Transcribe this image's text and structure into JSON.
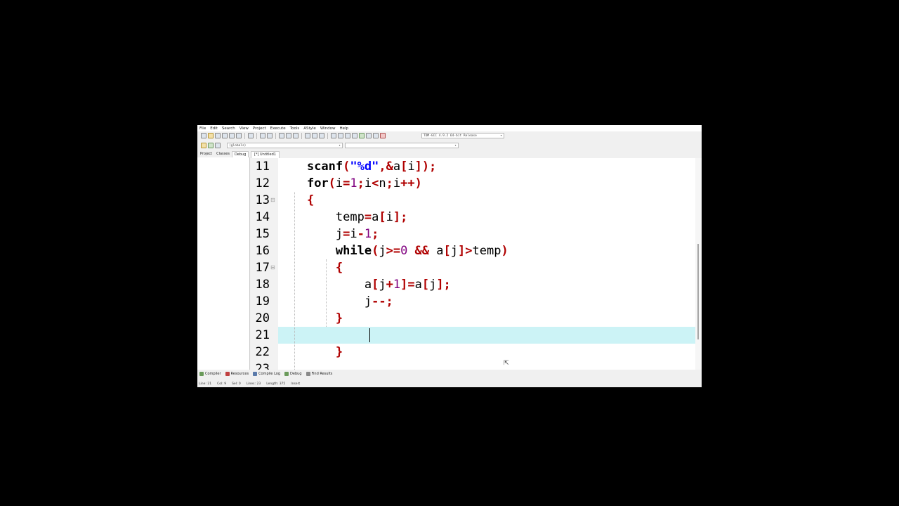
{
  "menu": [
    "File",
    "Edit",
    "Search",
    "View",
    "Project",
    "Execute",
    "Tools",
    "AStyle",
    "Window",
    "Help"
  ],
  "compiler_select": "TDM-GCC 4.9.2 64-bit Release",
  "globals_select": "(globals)",
  "left_tabs": [
    "Project",
    "Classes",
    "Debug"
  ],
  "document_tab": "[*] Untitled1",
  "editor": {
    "lines": [
      {
        "n": "11",
        "code": [
          [
            "",
            "    "
          ],
          [
            "k",
            "scanf"
          ],
          [
            "p",
            "("
          ],
          [
            "s",
            "\"%d\""
          ],
          [
            "p",
            ",&"
          ],
          [
            "",
            "a"
          ],
          [
            "p",
            "["
          ],
          [
            "",
            "i"
          ],
          [
            "p",
            "]);"
          ]
        ]
      },
      {
        "n": "12",
        "code": [
          [
            "",
            "    "
          ],
          [
            "k",
            "for"
          ],
          [
            "p",
            "("
          ],
          [
            "",
            "i"
          ],
          [
            "p",
            "="
          ],
          [
            "n",
            "1"
          ],
          [
            "p",
            ";"
          ],
          [
            "",
            "i"
          ],
          [
            "p",
            "<"
          ],
          [
            "",
            "n"
          ],
          [
            "p",
            ";"
          ],
          [
            "",
            "i"
          ],
          [
            "p",
            "++)"
          ]
        ]
      },
      {
        "n": "13",
        "code": [
          [
            "",
            "    "
          ],
          [
            "p",
            "{"
          ]
        ]
      },
      {
        "n": "14",
        "code": [
          [
            "",
            "        "
          ],
          [
            "",
            "temp"
          ],
          [
            "p",
            "="
          ],
          [
            "",
            "a"
          ],
          [
            "p",
            "["
          ],
          [
            "",
            "i"
          ],
          [
            "p",
            "];"
          ]
        ]
      },
      {
        "n": "15",
        "code": [
          [
            "",
            "        "
          ],
          [
            "",
            "j"
          ],
          [
            "p",
            "="
          ],
          [
            "",
            "i"
          ],
          [
            "p",
            "-"
          ],
          [
            "n",
            "1"
          ],
          [
            "p",
            ";"
          ]
        ]
      },
      {
        "n": "16",
        "code": [
          [
            "",
            "        "
          ],
          [
            "k",
            "while"
          ],
          [
            "p",
            "("
          ],
          [
            "",
            "j"
          ],
          [
            "p",
            ">="
          ],
          [
            "n",
            "0"
          ],
          [
            "",
            ""
          ],
          [
            "p",
            " && "
          ],
          [
            "",
            "a"
          ],
          [
            "p",
            "["
          ],
          [
            "",
            "j"
          ],
          [
            "p",
            "]>"
          ],
          [
            "",
            "temp"
          ],
          [
            "p",
            ")"
          ]
        ]
      },
      {
        "n": "17",
        "code": [
          [
            "",
            "        "
          ],
          [
            "p",
            "{"
          ]
        ]
      },
      {
        "n": "18",
        "code": [
          [
            "",
            "            "
          ],
          [
            "",
            "a"
          ],
          [
            "p",
            "["
          ],
          [
            "",
            "j"
          ],
          [
            "p",
            "+"
          ],
          [
            "n",
            "1"
          ],
          [
            "p",
            "]="
          ],
          [
            "",
            "a"
          ],
          [
            "p",
            "["
          ],
          [
            "",
            "j"
          ],
          [
            "p",
            "];"
          ]
        ]
      },
      {
        "n": "19",
        "code": [
          [
            "",
            "            "
          ],
          [
            "",
            "j"
          ],
          [
            "p",
            "--;"
          ]
        ]
      },
      {
        "n": "20",
        "code": [
          [
            "",
            "        "
          ],
          [
            "p",
            "}"
          ]
        ]
      },
      {
        "n": "21",
        "code": [
          [
            "",
            ""
          ]
        ]
      },
      {
        "n": "22",
        "code": [
          [
            "",
            "        "
          ],
          [
            "p",
            "}"
          ]
        ]
      },
      {
        "n": "23",
        "code": [
          [
            "",
            ""
          ]
        ]
      }
    ]
  },
  "bottom_tabs": [
    "Compiler",
    "Resources",
    "Compile Log",
    "Debug",
    "Find Results"
  ],
  "status": {
    "line_label": "Line:",
    "line": "21",
    "col_label": "Col:",
    "col": "9",
    "sel_label": "Sel:",
    "sel": "0",
    "lines_label": "Lines:",
    "lines": "23",
    "length_label": "Length:",
    "length": "375",
    "mode": "Insert"
  }
}
